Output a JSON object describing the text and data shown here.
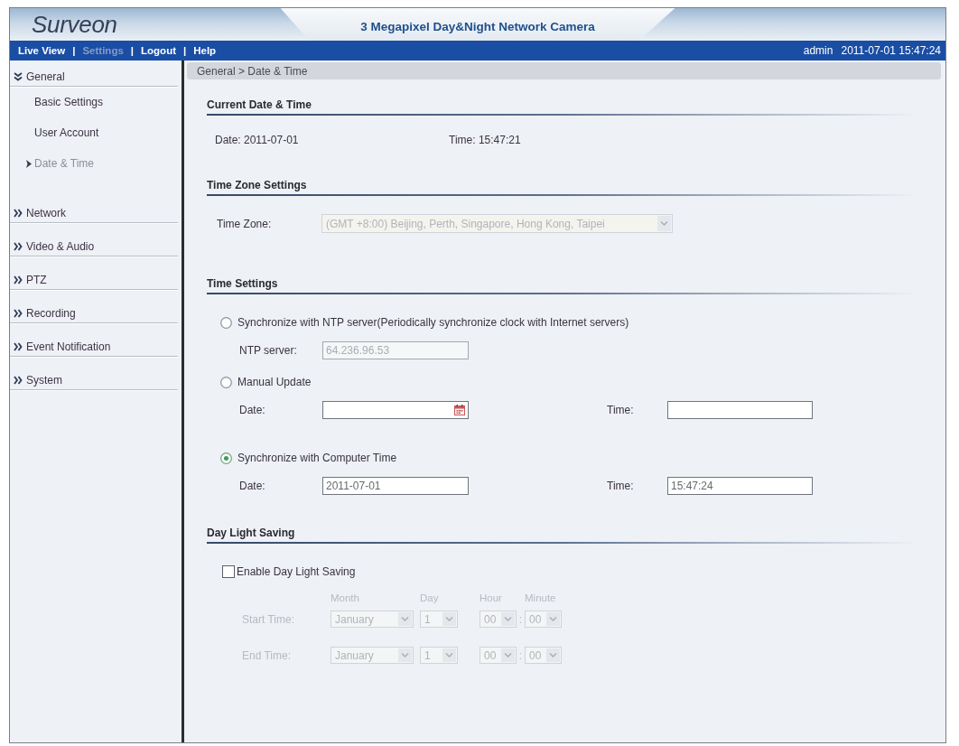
{
  "header": {
    "logo": "Surveon",
    "title": "3 Megapixel Day&Night Network Camera"
  },
  "nav": {
    "links": [
      {
        "label": "Live View",
        "selected": false
      },
      {
        "label": "Settings",
        "selected": true
      },
      {
        "label": "Logout",
        "selected": false
      },
      {
        "label": "Help",
        "selected": false
      }
    ],
    "separators": [
      "|",
      "|",
      "|"
    ],
    "user": "admin",
    "datetime": "2011-07-01 15:47:24"
  },
  "sidebar": {
    "items": [
      {
        "label": "General",
        "expanded": true,
        "children": [
          {
            "label": "Basic Settings",
            "selected": false
          },
          {
            "label": "User Account",
            "selected": false
          },
          {
            "label": "Date & Time",
            "selected": true
          }
        ]
      },
      {
        "label": "Network",
        "expanded": false
      },
      {
        "label": "Video & Audio",
        "expanded": false
      },
      {
        "label": "PTZ",
        "expanded": false
      },
      {
        "label": "Recording",
        "expanded": false
      },
      {
        "label": "Event Notification",
        "expanded": false
      },
      {
        "label": "System",
        "expanded": false
      }
    ]
  },
  "breadcrumb": "General > Date & Time",
  "current": {
    "title": "Current Date & Time",
    "date": "Date: 2011-07-01",
    "time": "Time: 15:47:21"
  },
  "time_zone": {
    "title": "Time Zone Settings",
    "label": "Time Zone:",
    "value": "(GMT +8:00) Beijing, Perth, Singapore, Hong Kong, Taipei",
    "disabled": true
  },
  "time_settings": {
    "title": "Time Settings",
    "options": [
      {
        "label": "Synchronize with NTP server(Periodically synchronize clock with Internet servers)",
        "selected": false,
        "fields": [
          {
            "label": "NTP server:",
            "value": "64.236.96.53",
            "disabled": true
          }
        ]
      },
      {
        "label": "Manual Update",
        "selected": false,
        "fields": [
          {
            "label": "Date:",
            "calendar": true,
            "disabled": false
          },
          {
            "label": "Time:",
            "disabled": false
          }
        ]
      },
      {
        "label": "Synchronize with Computer Time",
        "selected": true,
        "fields": [
          {
            "label": "Date:",
            "value": "2011-07-01",
            "disabled": false
          },
          {
            "label": "Time:",
            "value": "15:47:24",
            "disabled": false
          }
        ]
      }
    ]
  },
  "daylight_saving": {
    "title": "Day Light Saving",
    "enable": {
      "label": "Enable Day Light Saving",
      "checked": false
    },
    "columns": [
      "Month",
      "Day",
      "Hour",
      "Minute"
    ],
    "rows": [
      {
        "label": "Start Time:",
        "month": "January",
        "day": "1",
        "hour": "00",
        "separator": ":",
        "minute": "00"
      },
      {
        "label": "End Time:",
        "month": "January",
        "day": "1",
        "hour": "00",
        "separator": ":",
        "minute": "00"
      }
    ]
  }
}
